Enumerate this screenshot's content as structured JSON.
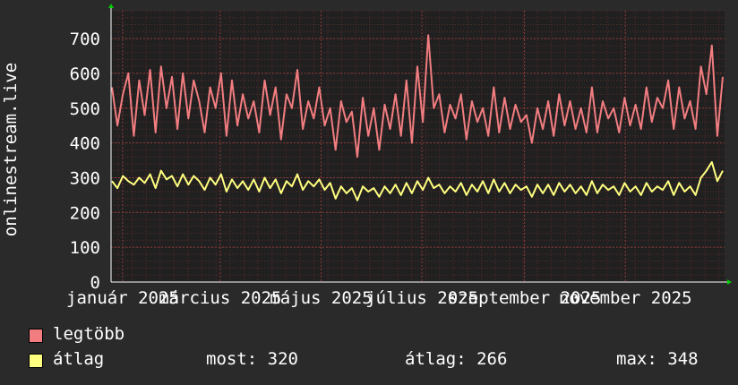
{
  "ylabel": "onlinestream.live",
  "legend": [
    {
      "label": "legtöbb",
      "color": "#f17d80"
    },
    {
      "label": "átlag",
      "color": "#ffff80"
    }
  ],
  "stats": {
    "now": "most: 320",
    "avg": "átlag: 266",
    "max": "max: 348"
  },
  "colors": {
    "background": "#2a2a2a",
    "plot_area": "#202020",
    "grid": "#5a2a2a",
    "axis": "#ffffff"
  },
  "chart_data": {
    "type": "line",
    "x_tick_labels": [
      "január 2025",
      "március 2025",
      "május 2025",
      "július 2025",
      "szeptember 2025",
      "november 2025"
    ],
    "x_tick_dates": [
      "2025-01-01",
      "2025-03-01",
      "2025-05-01",
      "2025-07-01",
      "2025-09-01",
      "2025-11-01"
    ],
    "x_range": [
      "2024-12-25",
      "2025-12-31"
    ],
    "ylim": [
      0,
      780
    ],
    "yticks": [
      0,
      100,
      200,
      300,
      400,
      500,
      600,
      700
    ],
    "grid": true,
    "series": [
      {
        "name": "legtöbb",
        "color": "#f17d80",
        "values": [
          560,
          450,
          540,
          600,
          420,
          580,
          480,
          610,
          430,
          620,
          500,
          590,
          440,
          600,
          470,
          580,
          520,
          430,
          560,
          500,
          600,
          420,
          580,
          450,
          540,
          470,
          520,
          430,
          580,
          480,
          560,
          410,
          540,
          500,
          610,
          440,
          520,
          470,
          560,
          450,
          500,
          380,
          520,
          460,
          490,
          360,
          530,
          420,
          500,
          380,
          510,
          440,
          540,
          420,
          580,
          400,
          620,
          460,
          710,
          500,
          540,
          430,
          510,
          470,
          540,
          410,
          520,
          460,
          500,
          420,
          560,
          430,
          530,
          440,
          510,
          460,
          480,
          400,
          500,
          440,
          520,
          420,
          540,
          450,
          520,
          440,
          500,
          430,
          560,
          430,
          520,
          470,
          500,
          430,
          530,
          450,
          510,
          440,
          560,
          460,
          530,
          500,
          580,
          440,
          560,
          470,
          520,
          440,
          620,
          540,
          680,
          420,
          590
        ],
        "note": ""
      },
      {
        "name": "átlag",
        "color": "#ffff80",
        "values": [
          290,
          270,
          305,
          290,
          280,
          300,
          285,
          310,
          270,
          320,
          295,
          305,
          275,
          310,
          280,
          305,
          290,
          265,
          300,
          280,
          310,
          260,
          295,
          270,
          290,
          265,
          295,
          260,
          300,
          270,
          295,
          255,
          290,
          275,
          310,
          265,
          290,
          275,
          295,
          265,
          285,
          240,
          275,
          255,
          270,
          235,
          275,
          260,
          270,
          245,
          275,
          255,
          280,
          250,
          285,
          255,
          290,
          265,
          300,
          270,
          280,
          255,
          275,
          260,
          285,
          250,
          280,
          260,
          290,
          255,
          295,
          260,
          285,
          255,
          280,
          265,
          275,
          245,
          280,
          255,
          280,
          250,
          285,
          260,
          280,
          255,
          275,
          250,
          290,
          255,
          280,
          265,
          275,
          250,
          285,
          260,
          275,
          250,
          285,
          260,
          275,
          265,
          290,
          250,
          285,
          260,
          275,
          250,
          300,
          320,
          345,
          290,
          320
        ],
        "note": ""
      }
    ]
  }
}
